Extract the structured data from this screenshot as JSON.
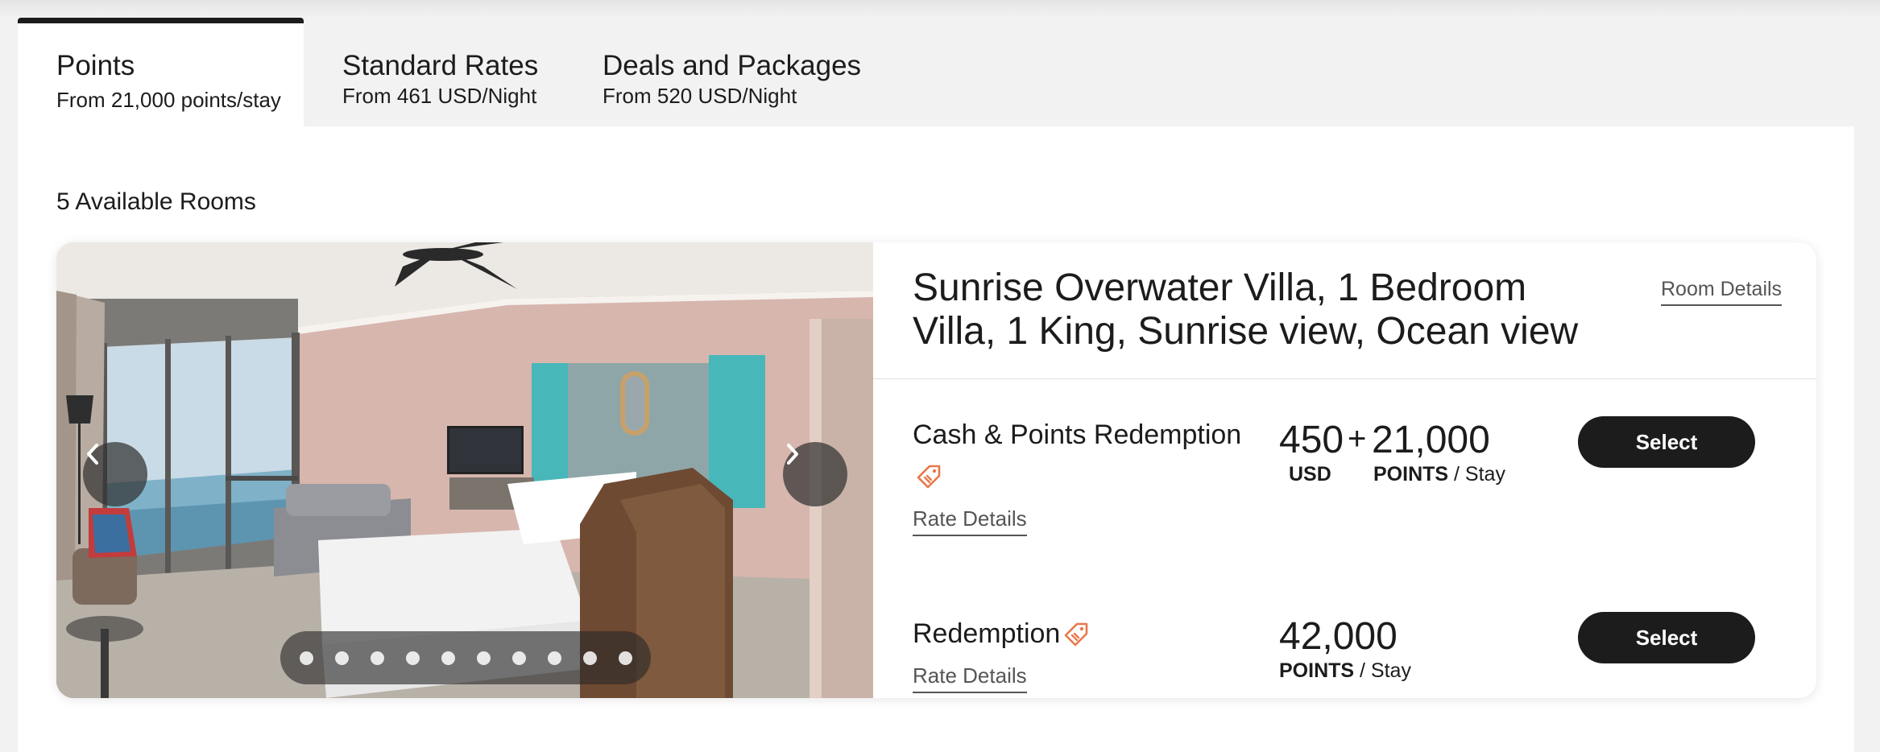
{
  "tabs": [
    {
      "name": "Points",
      "sub": "From 21,000 points/stay",
      "active": true
    },
    {
      "name": "Standard Rates",
      "sub": "From 461 USD/Night",
      "active": false
    },
    {
      "name": "Deals and Packages",
      "sub": "From 520 USD/Night",
      "active": false
    }
  ],
  "rooms_count": "5 Available Rooms",
  "room": {
    "title": "Sunrise Overwater Villa, 1 Bedroom Villa, 1 King, Sunrise view, Ocean view",
    "details_link": "Room Details",
    "carousel": {
      "prev_icon": "chevron-left-icon",
      "next_icon": "chevron-right-icon",
      "dot_count": 10
    },
    "rates": [
      {
        "name": "Cash & Points Redemption",
        "tag_icon": "price-tag-icon",
        "rate_details": "Rate Details",
        "cash": "450",
        "cash_unit": "USD",
        "plus": "+",
        "points": "21,000",
        "points_unit": "POINTS",
        "per": "/ Stay",
        "select": "Select"
      },
      {
        "name": "Redemption",
        "tag_icon": "price-tag-icon",
        "rate_details": "Rate Details",
        "points": "42,000",
        "points_unit": "POINTS",
        "per": "/ Stay",
        "select": "Select"
      }
    ]
  },
  "colors": {
    "tag_icon": "#e8784a",
    "button": "#1c1c1c",
    "background": "#f2f2f2"
  }
}
